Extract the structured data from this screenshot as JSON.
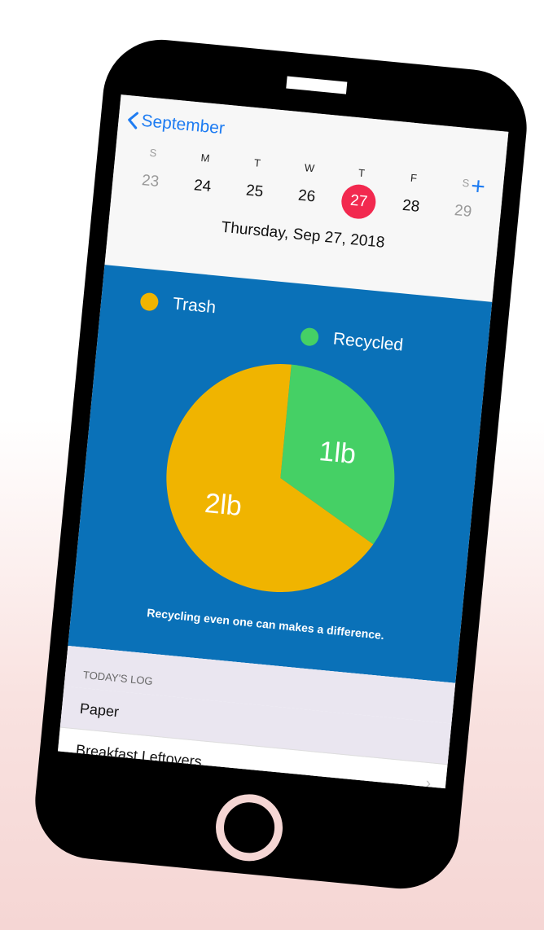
{
  "nav": {
    "back_label": "September",
    "add_label": "+"
  },
  "calendar": {
    "days": [
      {
        "dow": "S",
        "num": "23"
      },
      {
        "dow": "M",
        "num": "24"
      },
      {
        "dow": "T",
        "num": "25"
      },
      {
        "dow": "W",
        "num": "26"
      },
      {
        "dow": "T",
        "num": "27"
      },
      {
        "dow": "F",
        "num": "28"
      },
      {
        "dow": "S",
        "num": "29"
      }
    ],
    "selected_date": "Thursday, Sep 27, 2018"
  },
  "summary": {
    "legend": {
      "trash": "Trash",
      "recycled": "Recycled"
    },
    "caption": "Recycling even one can makes a difference."
  },
  "chart_data": {
    "type": "pie",
    "slices": [
      {
        "label": "Trash",
        "value": 2,
        "display": "2lb",
        "color": "#f0b400"
      },
      {
        "label": "Recycled",
        "value": 1,
        "display": "1lb",
        "color": "#45d065"
      }
    ]
  },
  "log": {
    "header": "TODAY'S LOG",
    "items": [
      "Paper",
      "Breakfast Leftovers",
      ""
    ]
  },
  "colors": {
    "accent": "#1e7cf2",
    "selected": "#f2294f",
    "summary_bg": "#0a71b8"
  }
}
